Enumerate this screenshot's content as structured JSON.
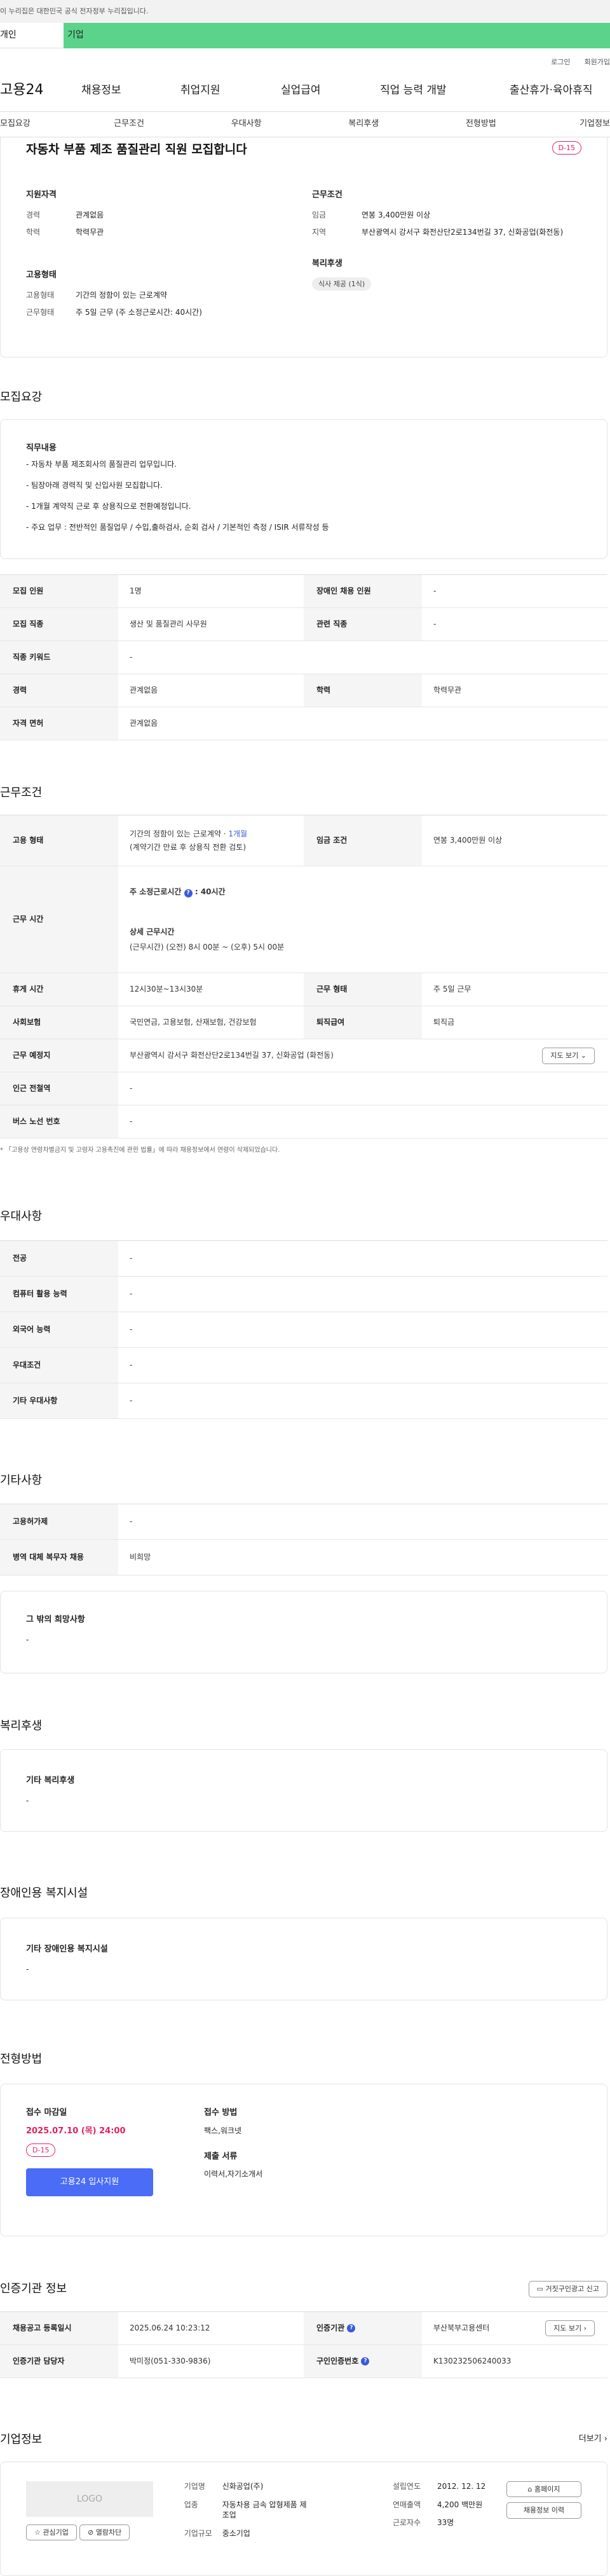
{
  "gov_banner": "이 누리집은 대한민국 공식 전자정부 누리집입니다.",
  "top_tabs": {
    "personal": "개인",
    "company": "기업"
  },
  "util": {
    "login": "로그인",
    "join": "회원가입"
  },
  "logo": "고용24",
  "gnb": [
    "채용정보",
    "취업지원",
    "실업급여",
    "직업 능력 개발",
    "출산휴가·육아휴직"
  ],
  "anchors": [
    "모집요강",
    "근무조건",
    "우대사항",
    "복리후생",
    "전형방법",
    "기업정보"
  ],
  "summary": {
    "title": "자동차 부품 제조 품질관리 직원 모집합니다",
    "dday": "D-15",
    "qual_title": "지원자격",
    "exp_label": "경력",
    "exp": "관계없음",
    "edu_label": "학력",
    "edu": "학력무관",
    "cond_title": "근무조건",
    "wage_label": "임금",
    "wage": "연봉 3,400만원 이상",
    "area_label": "지역",
    "area": "부산광역시 강서구 화전산단2로134번길 37, 신화공업(화전동)",
    "emp_title": "고용형태",
    "emp_label": "고용형태",
    "emp": "기간의 정함이 있는 근로계약",
    "work_label": "근무형태",
    "work": "주 5일 근무 (주 소정근로시간: 40시간)",
    "welfare_title": "복리후생",
    "welfare_tag": "식사 제공 (1식)"
  },
  "recruit": {
    "title": "모집요강",
    "duty_title": "직무내용",
    "duty_lines": [
      "- 자동차 부품 제조회사의 품질관리 업무입니다.",
      "- 팀장아래 경력직 및 신입사원 모집합니다.",
      "- 1개월 계약직 근로 후 상용직으로 전환예정입니다.",
      "- 주요 업무 : 전반적인 품질업무 / 수입,출하검사, 순회 검사 / 기본적인 측정 / ISIR 서류작성 등"
    ],
    "rows": [
      [
        "모집 인원",
        "1명",
        "장애인 채용 인원",
        "-"
      ],
      [
        "모집 직종",
        "생산 및 품질관리 사무원",
        "관련 직종",
        "-"
      ],
      [
        "직종 키워드",
        "-"
      ],
      [
        "경력",
        "관계없음",
        "학력",
        "학력무관"
      ],
      [
        "자격 면허",
        "관계없음"
      ]
    ]
  },
  "conditions": {
    "title": "근무조건",
    "emp_label": "고용 형태",
    "emp_line1": "기간의 정함이 있는 근로계약 · ",
    "emp_link": "1개월",
    "emp_line2": "(계약기간 만료 후 상용직 전환 검토)",
    "wage_label": "임금 조건",
    "wage": "연봉 3,400만원 이상",
    "hours_label": "근무 시간",
    "hours_a": "주 소정근로시간",
    "hours_b": ": 40시간",
    "hours_detail_title": "상세 근무시간",
    "hours_detail": "(근무시간) (오전) 8시 00분 ~ (오후) 5시 00분",
    "rows": [
      [
        "휴게 시간",
        "12시30분~13시30분",
        "근무 형태",
        "주 5일 근무"
      ],
      [
        "사회보험",
        "국민연금, 고용보험, 산재보험, 건강보험",
        "퇴직급여",
        "퇴직금"
      ]
    ],
    "place_label": "근무 예정지",
    "place": "부산광역시 강서구 화전산단2로134번길 37, 신화공업 (화전동)",
    "map_btn": "지도 보기",
    "rows2": [
      [
        "인근 전철역",
        "-"
      ],
      [
        "버스 노선 번호",
        "-"
      ]
    ],
    "note": "* 「고용상 연령차별금지 및 고령자 고용촉진에 관한 법률」에 따라 채용정보에서 연령이 삭제되었습니다."
  },
  "preference": {
    "title": "우대사항",
    "rows": [
      [
        "전공",
        "-"
      ],
      [
        "컴퓨터 활용 능력",
        "-"
      ],
      [
        "외국어 능력",
        "-"
      ],
      [
        "우대조건",
        "-"
      ],
      [
        "기타 우대사항",
        "-"
      ]
    ]
  },
  "etc": {
    "title": "기타사항",
    "rows": [
      [
        "고용허가제",
        "-"
      ],
      [
        "병역 대체 복무자 채용",
        "비희망"
      ]
    ],
    "hope_title": "그 밖의 희망사항",
    "hope": "-"
  },
  "welfare": {
    "title": "복리후생",
    "box_title": "기타 복리후생",
    "box": "-"
  },
  "disability": {
    "title": "장애인용 복지시설",
    "box_title": "기타 장애인용 복지시설",
    "box": "-"
  },
  "process": {
    "title": "전형방법",
    "deadline_title": "접수 마감일",
    "deadline": "2025.07.10 (목) 24:00",
    "dday": "D-15",
    "apply_btn": "고용24 입사지원",
    "method_title": "접수 방법",
    "method": "팩스,워크넷",
    "docs_title": "제출 서류",
    "docs": "이력서,자기소개서"
  },
  "cert": {
    "title": "인증기관 정보",
    "report_btn": "거짓구인광고 신고",
    "r1": [
      "채용공고 등록일시",
      "2025.06.24 10:23:12",
      "인증기관",
      "부산북부고용센터",
      "지도 보기"
    ],
    "r2": [
      "인증기관 담당자",
      "박미정(051-330-9836)",
      "구인인증번호",
      "K130232506240033"
    ]
  },
  "company": {
    "title": "기업정보",
    "more": "더보기",
    "logo": "LOGO",
    "fav_btn": "관심기업",
    "block_btn": "열람차단",
    "name_label": "기업명",
    "name": "신화공업(주)",
    "ind_label": "업종",
    "ind": "자동차용 금속 압형제품 제조업",
    "size_label": "기업규모",
    "size": "중소기업",
    "year_label": "설립연도",
    "year": "2012. 12. 12",
    "sales_label": "연매출액",
    "sales": "4,200 백만원",
    "emp_label": "근로자수",
    "emp": "33명",
    "home_btn": "홈페이지",
    "hist_btn": "채용정보 이력"
  }
}
